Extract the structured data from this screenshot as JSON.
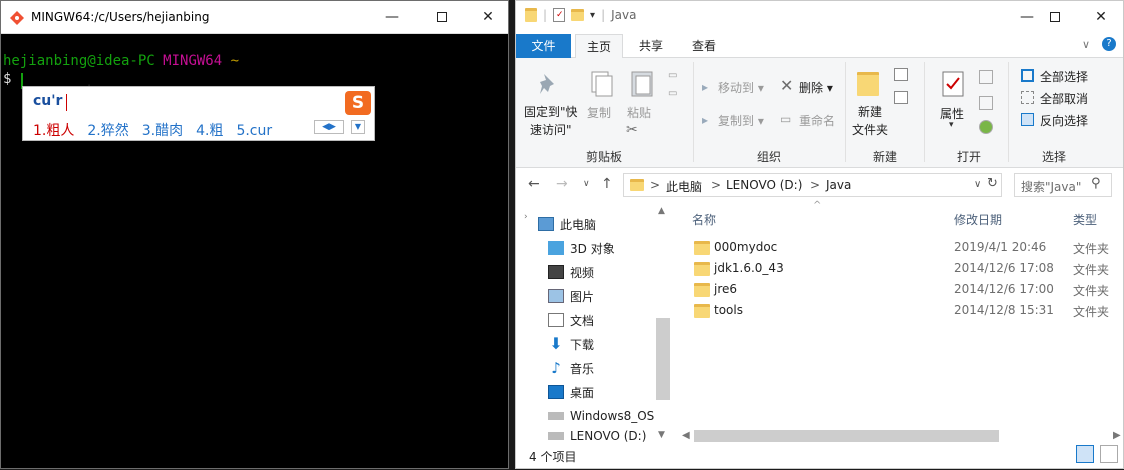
{
  "terminal": {
    "title": "MINGW64:/c/Users/hejianbing",
    "prompt_user": "hejianbing@idea-PC",
    "prompt_env": "MINGW64",
    "prompt_dir": "~",
    "prompt_symbol": "$",
    "ime": {
      "composition": "cu'r",
      "candidates": [
        "1.粗人",
        "2.猝然",
        "3.醋肉",
        "4.粗",
        "5.cur"
      ],
      "logo": "S"
    },
    "colors": {
      "user": "#13a10e",
      "env": "#c50f93",
      "dir": "#c19c00"
    }
  },
  "explorer": {
    "title": "Java",
    "tabs": {
      "file": "文件",
      "home": "主页",
      "share": "共享",
      "view": "查看"
    },
    "ribbon": {
      "pin": "固定到\"快\n速访问\"",
      "copy": "复制",
      "paste": "粘贴",
      "move_to": "移动到",
      "copy_to": "复制到",
      "delete": "删除",
      "rename": "重命名",
      "new_folder": "新建\n文件夹",
      "properties": "属性",
      "select_all": "全部选择",
      "select_none": "全部取消",
      "invert_select": "反向选择",
      "groups": [
        "剪贴板",
        "组织",
        "新建",
        "打开",
        "选择"
      ]
    },
    "address": {
      "crumbs": [
        "此电脑",
        "LENOVO (D:)",
        "Java"
      ],
      "sep": ">"
    },
    "search_placeholder": "搜索\"Java\"",
    "nav": [
      {
        "label": "此电脑",
        "icon": "pc-icon"
      },
      {
        "label": "3D 对象",
        "icon": "3d-icon"
      },
      {
        "label": "视频",
        "icon": "video-icon"
      },
      {
        "label": "图片",
        "icon": "picture-icon"
      },
      {
        "label": "文档",
        "icon": "document-icon"
      },
      {
        "label": "下载",
        "icon": "download-icon"
      },
      {
        "label": "音乐",
        "icon": "music-icon"
      },
      {
        "label": "桌面",
        "icon": "desktop-icon"
      },
      {
        "label": "Windows8_OS",
        "icon": "drive-icon"
      },
      {
        "label": "LENOVO (D:)",
        "icon": "drive-icon"
      }
    ],
    "columns": {
      "name": "名称",
      "date": "修改日期",
      "type": "类型"
    },
    "files": [
      {
        "name": "000mydoc",
        "date": "2019/4/1 20:46",
        "type": "文件夹"
      },
      {
        "name": "jdk1.6.0_43",
        "date": "2014/12/6 17:08",
        "type": "文件夹"
      },
      {
        "name": "jre6",
        "date": "2014/12/6 17:00",
        "type": "文件夹"
      },
      {
        "name": "tools",
        "date": "2014/12/8 15:31",
        "type": "文件夹"
      }
    ],
    "status": "4 个项目"
  }
}
